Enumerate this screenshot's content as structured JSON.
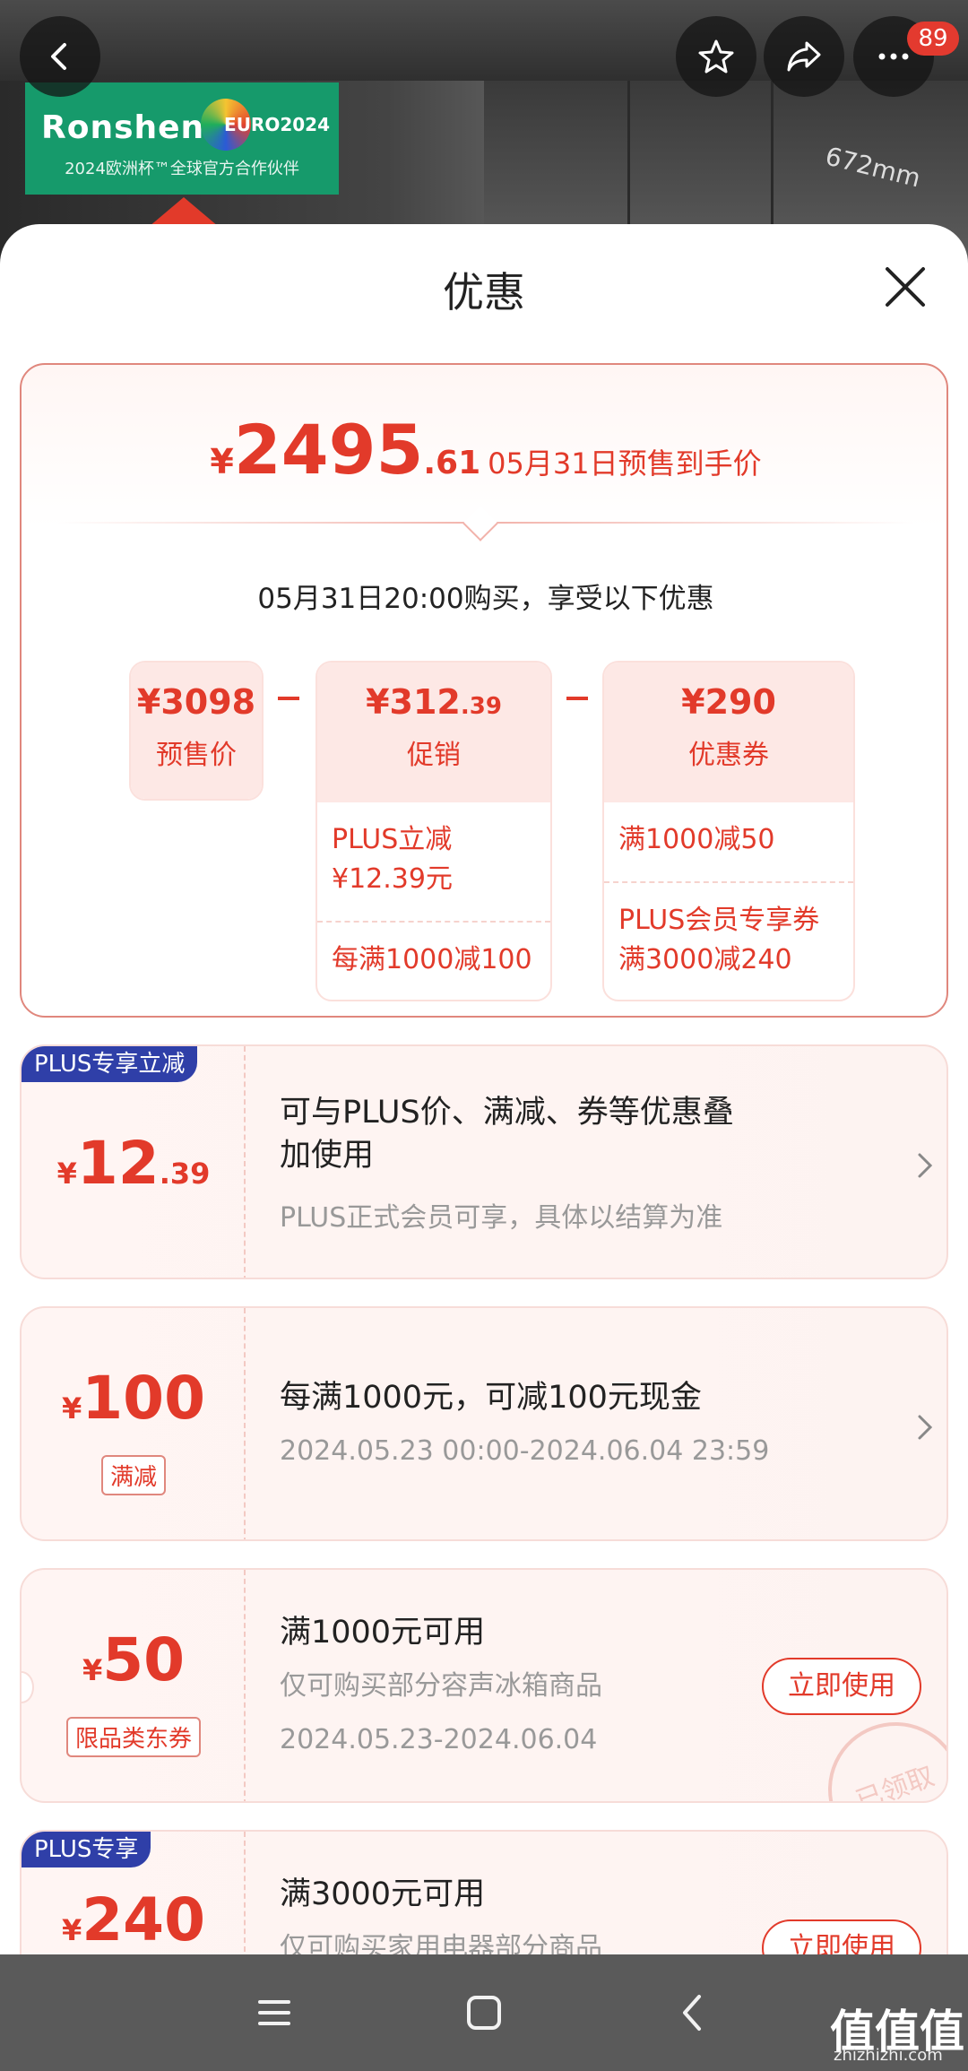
{
  "header": {
    "badge_count": "89",
    "brand_name": "Ronshen",
    "brand_event": "EURO2024",
    "brand_sub": "2024欧洲杯™全球官方合作伙伴",
    "dimension": "672mm"
  },
  "sheet": {
    "title": "优惠"
  },
  "summary": {
    "currency": "¥",
    "price_int": "2495",
    "price_dec": ".61",
    "price_label": "05月31日预售到手价",
    "buy_note": "05月31日20:00购买，享受以下优惠",
    "components": [
      {
        "currency": "¥",
        "value": "3098",
        "dec": "",
        "label": "预售价",
        "rows": []
      },
      {
        "currency": "¥",
        "value": "312",
        "dec": ".39",
        "label": "促销",
        "rows": [
          "PLUS立减\n¥12.39元",
          "每满1000减100"
        ]
      },
      {
        "currency": "¥",
        "value": "290",
        "dec": "",
        "label": "优惠券",
        "rows": [
          "满1000减50",
          "PLUS会员专享券\n满3000减240"
        ]
      }
    ]
  },
  "promos": [
    {
      "tag": "PLUS专享立减",
      "currency": "¥",
      "amount": "12",
      "dec": ".39",
      "chip": "",
      "title": "可与PLUS价、满减、券等优惠叠\n加使用",
      "sub1": "PLUS正式会员可享，具体以结算为准",
      "sub2": "",
      "button": ""
    },
    {
      "tag": "",
      "currency": "¥",
      "amount": "100",
      "dec": "",
      "chip": "满减",
      "title": "每满1000元，可减100元现金",
      "sub1": "2024.05.23 00:00-2024.06.04 23:59",
      "sub2": "",
      "button": ""
    },
    {
      "tag": "",
      "currency": "¥",
      "amount": "50",
      "dec": "",
      "chip": "限品类东券",
      "title": "满1000元可用",
      "sub1": "仅可购买部分容声冰箱商品",
      "sub2": "2024.05.23-2024.06.04",
      "button": "立即使用",
      "stamp": "已领取"
    },
    {
      "tag": "PLUS专享",
      "currency": "¥",
      "amount": "240",
      "dec": "",
      "chip": "",
      "title": "满3000元可用",
      "sub1": "仅可购买家用电器部分商品",
      "sub2": "",
      "button": "立即使用"
    }
  ],
  "watermark": {
    "text": "值值值",
    "url": "zhizhizhi.com"
  },
  "colors": {
    "accent": "#e23a2a",
    "plus_tag": "#2f3fa8"
  }
}
